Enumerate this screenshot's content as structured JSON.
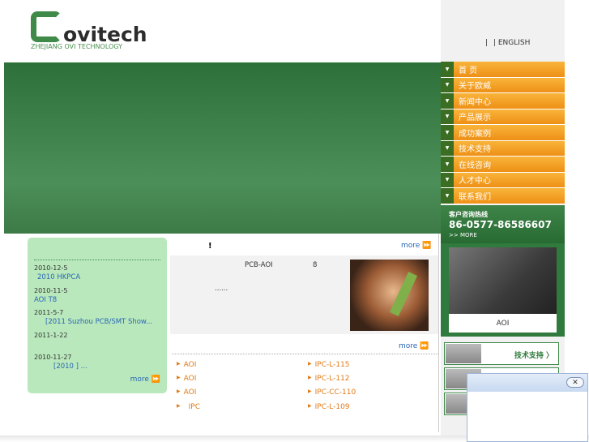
{
  "header": {
    "logo_text": "ovitech",
    "logo_sub": "ZHEJIANG OVI TECHNOLOGY",
    "lang_sep1": "|",
    "lang_sep2": "|",
    "lang_english": "ENGLISH"
  },
  "nav": {
    "items": [
      {
        "label": "首 页"
      },
      {
        "label": "关于欧威"
      },
      {
        "label": "新闻中心"
      },
      {
        "label": "产品展示"
      },
      {
        "label": "成功案例"
      },
      {
        "label": "技术支持"
      },
      {
        "label": "在线咨询"
      },
      {
        "label": "人才中心"
      },
      {
        "label": "联系我们"
      }
    ],
    "arrow": "▼"
  },
  "hotline": {
    "title": "客户咨询热线",
    "phone": "86-0577-86586607",
    "more": ">> MORE"
  },
  "product": {
    "label": "AOI"
  },
  "side_links": [
    {
      "label": "技术支持 〉"
    },
    {
      "label": ""
    },
    {
      "label": ""
    }
  ],
  "news": {
    "items": [
      {
        "date": "2010-12-5",
        "title": "2010 HKPCA"
      },
      {
        "date": "2010-11-5",
        "title": "AOI  T8"
      },
      {
        "date": "2011-5-7",
        "title": "[2011      Suzhou PCB/SMT Show..."
      },
      {
        "date": "2011-1-22",
        "title": ""
      },
      {
        "date": "2010-11-27",
        "title": "[2010          ]      ..."
      }
    ],
    "more": "more ⏩"
  },
  "center": {
    "title": "!",
    "more1": "more ⏩",
    "feature_l1": "PCB-AOI",
    "feature_l2": "8",
    "feature_l3": "......",
    "more2": "more ⏩",
    "left_list": [
      "AOI",
      "AOI",
      "AOI",
      "IPC"
    ],
    "right_list": [
      "IPC-L-115",
      "IPC-L-112",
      "IPC-CC-110",
      "IPC-L-109"
    ],
    "bullet": "▶"
  },
  "popup": {
    "close": "✕"
  }
}
